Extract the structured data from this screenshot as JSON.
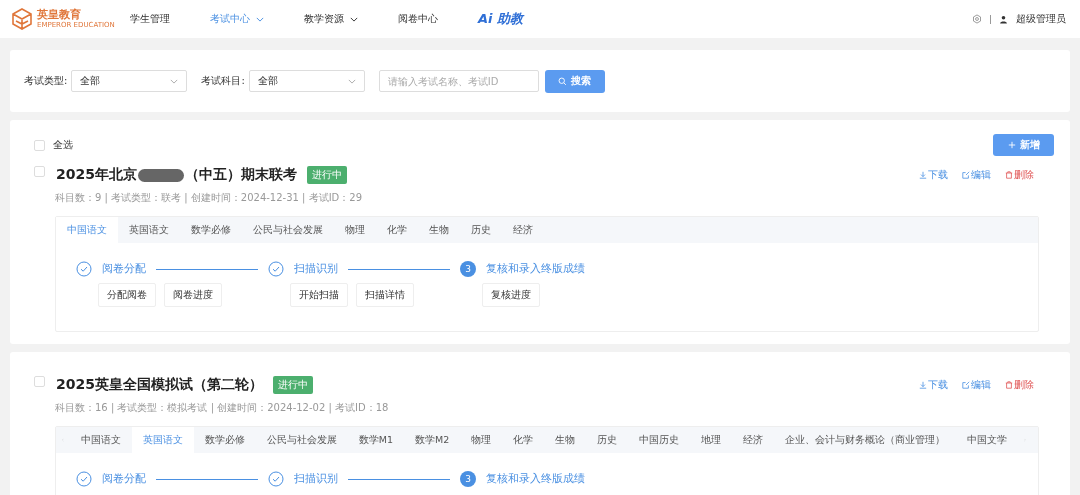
{
  "header": {
    "logo_text": "英皇教育",
    "logo_subtext": "EMPEROR EDUCATION",
    "nav": [
      {
        "label": "学生管理",
        "selected": false,
        "dropdown": false
      },
      {
        "label": "考试中心",
        "selected": true,
        "dropdown": true
      },
      {
        "label": "教学资源",
        "selected": false,
        "dropdown": true
      },
      {
        "label": "阅卷中心",
        "selected": false,
        "dropdown": false
      }
    ],
    "ai_label": "Ai 助教",
    "user": "超级管理员"
  },
  "filters": {
    "exam_type": {
      "label": "考试类型:",
      "value": "全部"
    },
    "subject": {
      "label": "考试科目:",
      "value": "全部"
    },
    "search": {
      "placeholder": "请输入考试名称、考试ID"
    },
    "search_button": "搜索"
  },
  "select_all": {
    "label": "全选",
    "checked": false
  },
  "new_button": "新增",
  "exams": [
    {
      "title_before": "2025年北京",
      "redacted": true,
      "title_after": "（中五）期末联考",
      "status": "进行中",
      "checked": false,
      "meta": "科目数：9 | 考试类型：联考 | 创建时间：2024-12-31 | 考试ID：29",
      "actions": [
        {
          "kind": "download",
          "label": "下载"
        },
        {
          "kind": "edit",
          "label": "编辑"
        },
        {
          "kind": "delete",
          "label": "删除"
        }
      ],
      "tabs_scrollable": false,
      "tabs": [
        {
          "label": "中国语文",
          "selected": true
        },
        {
          "label": "英国语文",
          "selected": false
        },
        {
          "label": "数学必修",
          "selected": false
        },
        {
          "label": "公民与社会发展",
          "selected": false
        },
        {
          "label": "物理",
          "selected": false
        },
        {
          "label": "化学",
          "selected": false
        },
        {
          "label": "生物",
          "selected": false
        },
        {
          "label": "历史",
          "selected": false
        },
        {
          "label": "经济",
          "selected": false
        }
      ],
      "steps": [
        {
          "label": "阅卷分配",
          "completed": true,
          "buttons": [
            "分配阅卷",
            "阅卷进度"
          ]
        },
        {
          "label": "扫描识别",
          "completed": true,
          "buttons": [
            "开始扫描",
            "扫描详情"
          ]
        },
        {
          "label": "复核和录入终版成绩",
          "completed": false,
          "number": "3",
          "buttons": [
            "复核进度"
          ]
        }
      ]
    },
    {
      "title_before": "2025英皇全国模拟试（第二轮）",
      "redacted": false,
      "status": "进行中",
      "checked": false,
      "meta": "科目数：16 | 考试类型：模拟考试 | 创建时间：2024-12-02 | 考试ID：18",
      "actions": [
        {
          "kind": "download",
          "label": "下载"
        },
        {
          "kind": "edit",
          "label": "编辑"
        },
        {
          "kind": "delete",
          "label": "删除"
        }
      ],
      "tabs_scrollable": true,
      "tabs": [
        {
          "label": "中国语文",
          "selected": false
        },
        {
          "label": "英国语文",
          "selected": true
        },
        {
          "label": "数学必修",
          "selected": false
        },
        {
          "label": "公民与社会发展",
          "selected": false
        },
        {
          "label": "数学M1",
          "selected": false
        },
        {
          "label": "数学M2",
          "selected": false
        },
        {
          "label": "物理",
          "selected": false
        },
        {
          "label": "化学",
          "selected": false
        },
        {
          "label": "生物",
          "selected": false
        },
        {
          "label": "历史",
          "selected": false
        },
        {
          "label": "中国历史",
          "selected": false
        },
        {
          "label": "地理",
          "selected": false
        },
        {
          "label": "经济",
          "selected": false
        },
        {
          "label": "企业、会计与财务概论（商业管理）",
          "selected": false
        },
        {
          "label": "中国文学",
          "selected": false
        }
      ],
      "steps": [
        {
          "label": "阅卷分配",
          "completed": true
        },
        {
          "label": "扫描识别",
          "completed": true
        },
        {
          "label": "复核和录入终版成绩",
          "completed": false,
          "number": "3"
        }
      ]
    }
  ]
}
